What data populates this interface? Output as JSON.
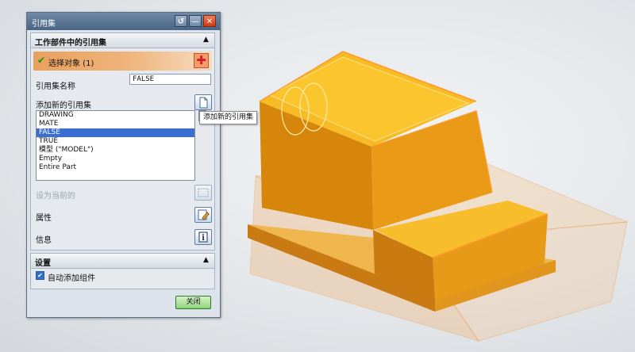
{
  "dialog": {
    "title": "引用集",
    "group_main": {
      "header": "工作部件中的引用集",
      "select_object": "选择对象 (1)",
      "name_label": "引用集名称",
      "name_value": "FALSE",
      "add_new_label": "添加新的引用集",
      "list_items": [
        "DRAWING",
        "MATE",
        "FALSE",
        "TRUE",
        "模型 (\"MODEL\")",
        "Empty",
        "Entire Part"
      ],
      "selected_item": "FALSE",
      "set_current_label": "设为当前的",
      "properties_label": "属性",
      "info_label": "信息"
    },
    "group_settings": {
      "header": "设置",
      "auto_add_label": "自动添加组件",
      "auto_add_checked": true
    },
    "close_button": "关闭",
    "tooltip": "添加新的引用集"
  },
  "icons": [
    "reset-icon",
    "minimize-icon",
    "close-icon",
    "check-icon",
    "crosshair-icon",
    "new-document-icon",
    "properties-icon",
    "info-icon",
    "collapse-icon"
  ],
  "colors": {
    "titlebar": "#4a6584",
    "selection_row": "#e9a05c",
    "list_selected": "#3a6fd1",
    "model_orange": "#f3a91f",
    "highlight_edge": "#ff9a2a"
  }
}
